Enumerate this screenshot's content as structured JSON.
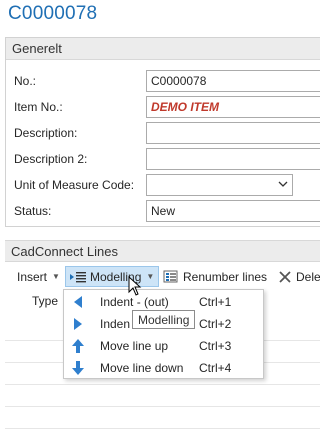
{
  "page": {
    "title": "C0000078"
  },
  "general": {
    "header": "Generelt",
    "fields": [
      {
        "label": "No.:",
        "value": "C0000078"
      },
      {
        "label": "Item No.:",
        "value": "DEMO ITEM"
      },
      {
        "label": "Description:",
        "value": ""
      },
      {
        "label": "Description 2:",
        "value": ""
      },
      {
        "label": "Unit of Measure Code:",
        "value": ""
      },
      {
        "label": "Status:",
        "value": "New"
      }
    ]
  },
  "lines": {
    "header": "CadConnect Lines",
    "toolbar": {
      "insert": "Insert",
      "modelling": "Modelling",
      "renumber": "Renumber lines",
      "delete": "Dele"
    },
    "columns": {
      "type": "Type"
    }
  },
  "menu": {
    "items": [
      {
        "label": "Indent - (out)",
        "shortcut": "Ctrl+1",
        "icon": "arrow-left-icon"
      },
      {
        "label": "Inden",
        "shortcut": "Ctrl+2",
        "icon": "arrow-right-icon"
      },
      {
        "label": "Move line up",
        "shortcut": "Ctrl+3",
        "icon": "arrow-up-icon"
      },
      {
        "label": "Move line down",
        "shortcut": "Ctrl+4",
        "icon": "arrow-down-icon"
      }
    ]
  },
  "tooltip": {
    "text": "Modelling"
  },
  "colors": {
    "accent": "#1f6fb4",
    "icon_blue": "#2f7fce",
    "demo_red": "#c0392b"
  }
}
